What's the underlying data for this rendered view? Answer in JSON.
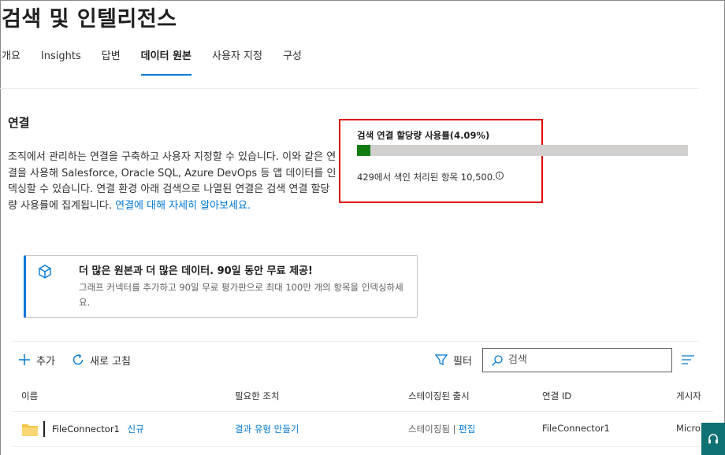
{
  "page": {
    "title": "검색 및 인텔리전스"
  },
  "tabs": [
    {
      "label": "개요",
      "active": false
    },
    {
      "label": "Insights",
      "active": false
    },
    {
      "label": "답변",
      "active": false
    },
    {
      "label": "데이터 원본",
      "active": true
    },
    {
      "label": "사용자 지정",
      "active": false
    },
    {
      "label": "구성",
      "active": false
    }
  ],
  "connections": {
    "title": "연결",
    "description": "조직에서 관리하는 연결을 구축하고 사용자 지정할 수 있습니다. 이와 같은 연결을 사용해 Salesforce, Oracle SQL, Azure DevOps 등 앱 데이터를 인덱싱할 수 있습니다. 연결 환경 아래 검색으로 나열된 연결은 검색 연결 할당량 사용률에 집계됩니다. ",
    "learn_more": "연결에 대해 자세히 알아보세요."
  },
  "quota": {
    "title": "검색 연결 할당량 사용률(4.09%)",
    "percent": 4.09,
    "count_text": "429에서 색인 처리된 항목 10,500.",
    "info_icon": "info-icon"
  },
  "promo": {
    "icon": "connector-cube-icon",
    "title": "더 많은 원본과 더 많은 데이터. 90일 동안 무료 제공!",
    "body": "그래프 커넥터를 추가하고 90일 무료 평가판으로 최대 100만 개의 항목을 인덱싱하세요."
  },
  "toolbar": {
    "add_label": "추가",
    "refresh_label": "새로 고침",
    "filter_label": "필터",
    "search_placeholder": "검색",
    "icons": [
      "plus-icon",
      "refresh-icon",
      "filter-icon",
      "search-icon",
      "menu-icon"
    ]
  },
  "table": {
    "columns": [
      "이름",
      "필요한 조치",
      "스테이징된 출시",
      "연결 ID",
      "게시자"
    ],
    "rows": [
      {
        "name": "FileConnector1",
        "badge": "신규",
        "action": "결과 유형 만들기",
        "staged": "스테이징됨",
        "staged_sep": "|",
        "staged_edit": "편집",
        "connection_id": "FileConnector1",
        "publisher": "Micros"
      }
    ]
  },
  "colors": {
    "accent": "#0078d4",
    "quota_fill": "#107c10",
    "highlight_border": "#e00000",
    "folder": "#f4c542"
  }
}
